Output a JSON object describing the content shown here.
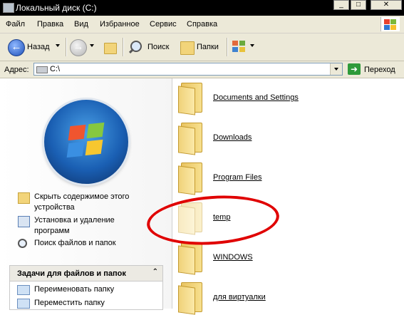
{
  "window": {
    "title": "Локальный диск (C:)",
    "controls": {
      "minimize": "_",
      "maximize": "□",
      "close": "✕"
    }
  },
  "menu": [
    "Файл",
    "Правка",
    "Вид",
    "Избранное",
    "Сервис",
    "Справка"
  ],
  "toolbar": {
    "back_label": "Назад",
    "search_label": "Поиск",
    "folders_label": "Папки",
    "back_glyph": "←",
    "forward_glyph": "→"
  },
  "address": {
    "label": "Адрес:",
    "value": "C:\\",
    "go_label": "Переход",
    "go_glyph": "➜"
  },
  "sidebar": {
    "links": [
      {
        "label": "Скрыть содержимое этого устройства",
        "icon": "folder-icon"
      },
      {
        "label": "Установка и удаление программ",
        "icon": "programs-icon"
      },
      {
        "label": "Поиск файлов и папок",
        "icon": "search-icon"
      }
    ],
    "tasks": {
      "header": "Задачи для файлов и папок",
      "collapse_glyph": "⌃",
      "items": [
        "Переименовать папку",
        "Переместить папку"
      ]
    }
  },
  "folders": [
    {
      "name": "Documents and Settings",
      "highlighted": false
    },
    {
      "name": "Downloads",
      "highlighted": false
    },
    {
      "name": "Program Files",
      "highlighted": false
    },
    {
      "name": "temp",
      "highlighted": true
    },
    {
      "name": "WINDOWS",
      "highlighted": false
    },
    {
      "name": "для виртуалки",
      "highlighted": false
    }
  ],
  "colors": {
    "annotation": "#e00000",
    "titlebar": "#000000",
    "chrome": "#ece9d8",
    "folder": "#f2d47a"
  }
}
